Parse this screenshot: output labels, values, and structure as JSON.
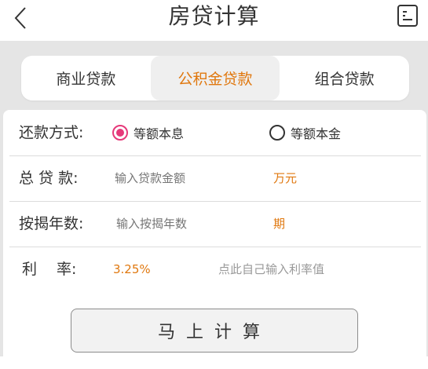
{
  "header": {
    "title": "房贷计算",
    "back_icon": "chevron-left-icon",
    "history_icon": "list-card-icon"
  },
  "tabs": [
    {
      "label": "商业贷款",
      "active": false
    },
    {
      "label": "公积金贷款",
      "active": true
    },
    {
      "label": "组合贷款",
      "active": false
    }
  ],
  "form": {
    "repay_label": "还款方式:",
    "repay_options": [
      {
        "label": "等额本息",
        "checked": true
      },
      {
        "label": "等额本金",
        "checked": false
      }
    ],
    "loan_label": "总 贷 款:",
    "loan_placeholder": "输入贷款金额",
    "loan_unit": "万元",
    "years_label": "按揭年数:",
    "years_placeholder": "输入按揭年数",
    "years_unit": "期",
    "rate_label": "利　  率:",
    "rate_value": "3.25%",
    "rate_hint": "点此自己输入利率值"
  },
  "calculate_label": "马上计算",
  "colors": {
    "accent": "#e0780f",
    "radio_checked": "#e6397a",
    "background": "#e5e5e5"
  }
}
